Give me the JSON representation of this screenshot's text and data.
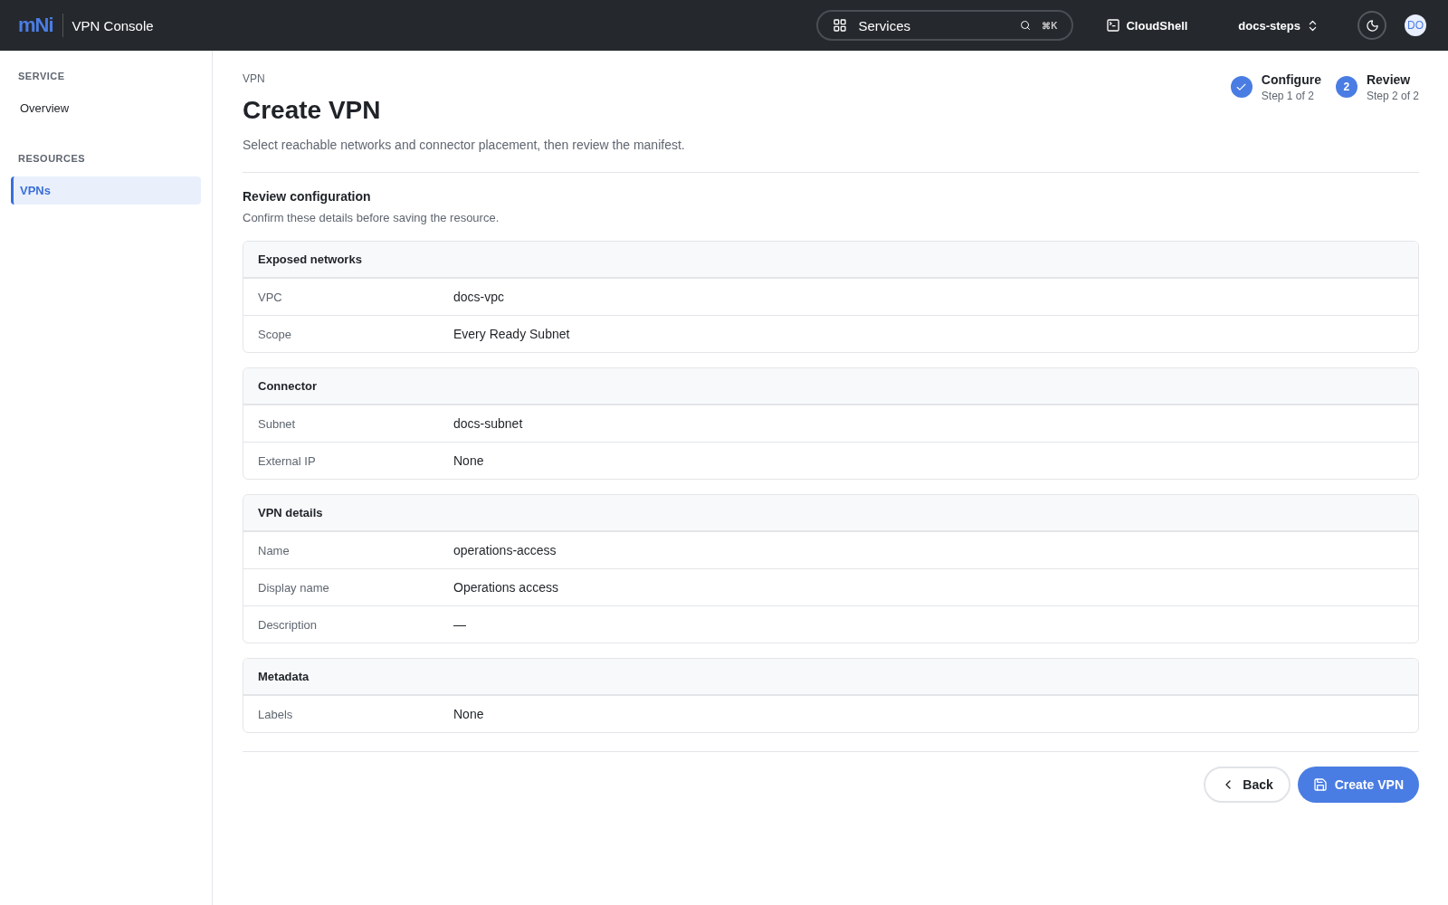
{
  "header": {
    "logo": "mNi",
    "title": "VPN Console",
    "search": {
      "value": "Services",
      "shortcut": "⌘K"
    },
    "cloudshell": "CloudShell",
    "project": "docs-steps",
    "avatar": "DO"
  },
  "sidebar": {
    "sections": [
      {
        "title": "SERVICE",
        "items": [
          {
            "label": "Overview",
            "selected": false
          }
        ]
      },
      {
        "title": "RESOURCES",
        "items": [
          {
            "label": "VPNs",
            "selected": true
          }
        ]
      }
    ]
  },
  "breadcrumb": "VPN",
  "title": "Create VPN",
  "subtitle": "Select reachable networks and connector placement, then review the manifest.",
  "steps": [
    {
      "label": "Configure",
      "caption": "Step 1 of 2",
      "kind": "done"
    },
    {
      "label": "Review",
      "caption": "Step 2 of 2",
      "kind": "current",
      "number": "2"
    }
  ],
  "review": {
    "title": "Review configuration",
    "subtitle": "Confirm these details before saving the resource.",
    "cards": [
      {
        "title": "Exposed networks",
        "rows": [
          {
            "label": "VPC",
            "value": "docs-vpc"
          },
          {
            "label": "Scope",
            "value": "Every Ready Subnet"
          }
        ]
      },
      {
        "title": "Connector",
        "rows": [
          {
            "label": "Subnet",
            "value": "docs-subnet"
          },
          {
            "label": "External IP",
            "value": "None"
          }
        ]
      },
      {
        "title": "VPN details",
        "rows": [
          {
            "label": "Name",
            "value": "operations-access"
          },
          {
            "label": "Display name",
            "value": "Operations access"
          },
          {
            "label": "Description",
            "value": "—"
          }
        ]
      },
      {
        "title": "Metadata",
        "rows": [
          {
            "label": "Labels",
            "value": "None"
          }
        ]
      }
    ]
  },
  "actions": {
    "back": "Back",
    "submit": "Create VPN"
  }
}
